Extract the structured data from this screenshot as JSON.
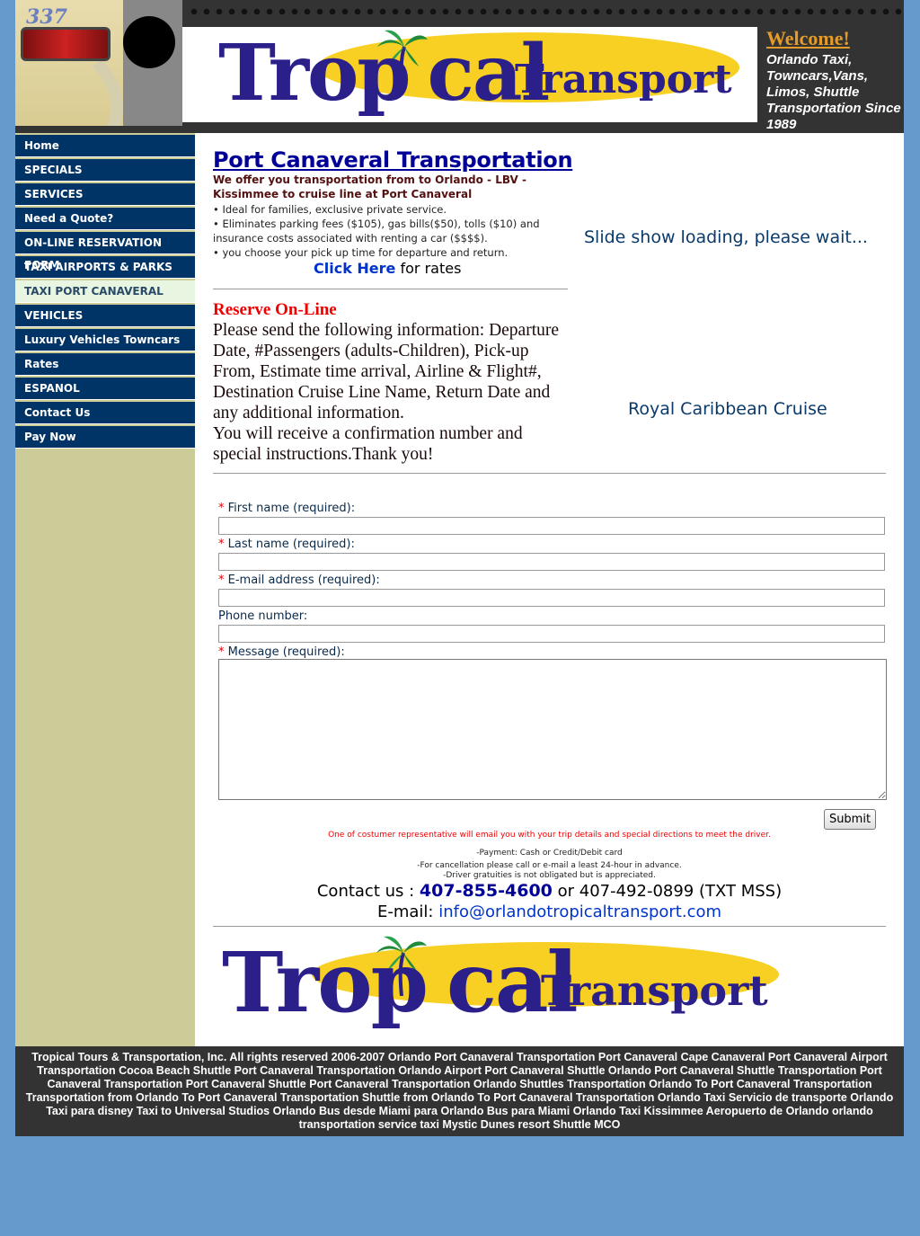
{
  "header": {
    "photo_number": "337",
    "welcome_title": "Welcome!",
    "welcome_text": "Orlando Taxi, Towncars,Vans, Limos, Shuttle Transportation Since 1989"
  },
  "logo": {
    "part1": "Trop",
    "part2": "cal",
    "part3": "Transport"
  },
  "nav": {
    "items": [
      {
        "label": "Home"
      },
      {
        "label": "SPECIALS"
      },
      {
        "label": "SERVICES"
      },
      {
        "label": "Need a Quote?"
      },
      {
        "label": "ON-LINE RESERVATION FORM"
      },
      {
        "label": "TAXI AIRPORTS & PARKS"
      },
      {
        "label": "TAXI PORT CANAVERAL"
      },
      {
        "label": "VEHICLES"
      },
      {
        "label": "Luxury Vehicles Towncars"
      },
      {
        "label": "Rates"
      },
      {
        "label": "ESPANOL"
      },
      {
        "label": "Contact Us"
      },
      {
        "label": "Pay Now"
      }
    ]
  },
  "main": {
    "title": "Port Canaveral Transportation",
    "intro": "We offer you transportation from to Orlando - LBV - Kissimmee to cruise line at Port Canaveral",
    "bullet1": "• Ideal for families, exclusive private service.",
    "bullet2": "• Eliminates parking fees ($105), gas bills($50), tolls ($10) and insurance costs associated with renting a car ($$$$).",
    "bullet3": "• you choose your pick up time for departure and return.",
    "rates_link": "Click Here",
    "rates_suffix": " for rates",
    "slideshow_msg": "Slide show loading, please wait...",
    "slide_caption": "Royal Caribbean Cruise",
    "reserve_title": "Reserve On-Line",
    "reserve_text": "Please send the following information: Departure Date, #Passengers (adults-Children), Pick-up From, Estimate time arrival, Airline & Flight#, Destination Cruise Line Name, Return Date and any additional information.",
    "reserve_text2": "You will receive a confirmation number and special instructions.Thank you!"
  },
  "form": {
    "first_name_label": "First name (required):",
    "last_name_label": "Last name (required):",
    "email_label": "E-mail address (required):",
    "phone_label": "Phone number:",
    "message_label": "Message (required):",
    "required_marker": "*",
    "first_name_value": "",
    "last_name_value": "",
    "email_value": "",
    "phone_value": "",
    "message_value": "",
    "submit_label": "Submit"
  },
  "notes": {
    "representative": "One of costumer representative will email you with your trip details and special directions to meet the driver.",
    "payment": "-Payment: Cash or Credit/Debit card",
    "cancellation": "-For cancellation please call or e-mail a least 24-hour in advance.",
    "gratuities": "-Driver gratuities is not obligated but is appreciated."
  },
  "contact": {
    "prefix": "Contact us : ",
    "phone1": "407-855-4600",
    "middle": " or 407-492-0899 (TXT MSS)",
    "email_prefix": "E-mail: ",
    "email": "info@orlandotropicaltransport.com"
  },
  "footer": {
    "text": "Tropical Tours & Transportation, Inc. All rights reserved 2006-2007 Orlando Port Canaveral Transportation Port Canaveral Cape Canaveral Port Canaveral Airport Transportation Cocoa Beach Shuttle Port Canaveral Transportation Orlando Airport Port Canaveral Shuttle Orlando Port Canaveral Shuttle Transportation Port Canaveral Transportation Port Canaveral Shuttle Port Canaveral Transportation Orlando Shuttles Transportation Orlando To Port Canaveral Transportation Transportation from Orlando To Port Canaveral Transportation Shuttle from Orlando To Port Canaveral Transportation Orlando Taxi Servicio de transporte Orlando Taxi para disney Taxi to Universal Studios Orlando Bus desde Miami para Orlando Bus para Miami Orlando Taxi Kissimmee Aeropuerto de Orlando orlando transportation service taxi Mystic Dunes resort Shuttle MCO"
  },
  "colors": {
    "page_bg": "#6699cc",
    "nav_bg": "#003366",
    "nav_active_bg": "#e8f5e0",
    "sidebar_bg": "#cccc99",
    "header_bg": "#333333",
    "title_color": "#000099",
    "logo_yellow": "#f7d023",
    "logo_blue": "#2b1f8a"
  }
}
